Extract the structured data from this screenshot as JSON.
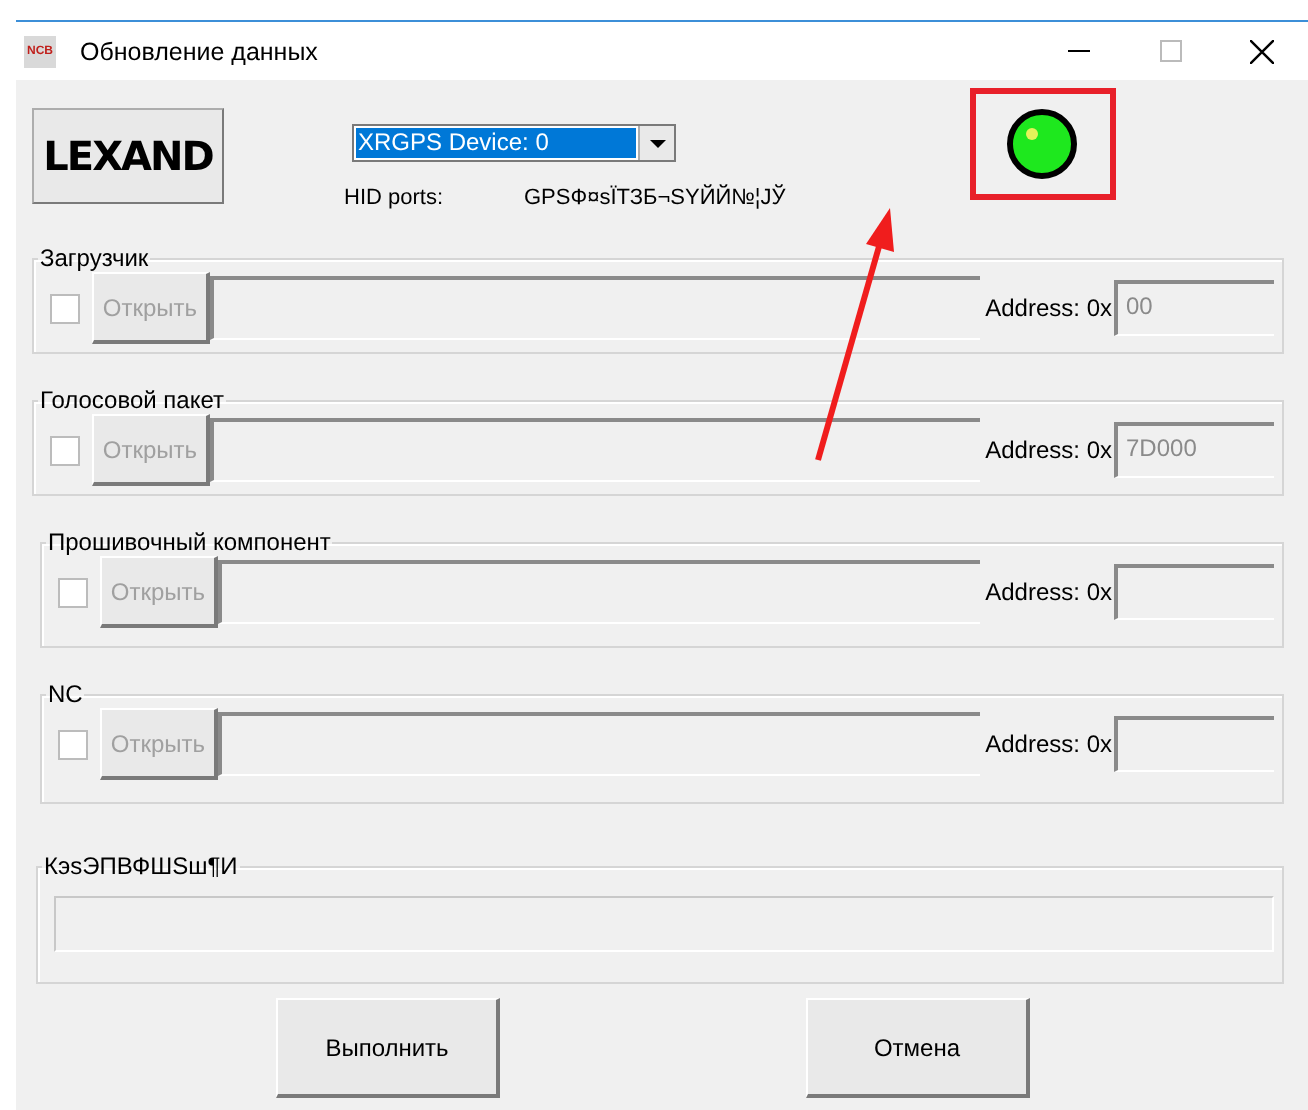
{
  "window": {
    "icon_text": "NCB",
    "title": "Обновление данных"
  },
  "logo": "LEXAND",
  "device_select": {
    "value": "XRGPS Device: 0"
  },
  "hid": {
    "label": "HID ports:",
    "value": "GPSФ¤sЇТЗБ¬SYЙЙ№¦JЎ"
  },
  "indicator": {
    "on": true,
    "highlighted": true
  },
  "groups": [
    {
      "title": "Загрузчик",
      "checked": false,
      "enabled": false,
      "open_button": "Открыть",
      "address_label": "Address: 0x",
      "address_value": "00"
    },
    {
      "title": "Голосовой пакет",
      "checked": false,
      "enabled": false,
      "open_button": "Открыть",
      "address_label": "Address: 0x",
      "address_value": "7D000"
    },
    {
      "title": "Прошивочный компонент",
      "checked": false,
      "enabled": false,
      "open_button": "Открыть",
      "address_label": "Address: 0x"
    },
    {
      "title": "NC",
      "checked": false,
      "enabled": false,
      "open_button": "Открыть",
      "address_label": "Address: 0x"
    }
  ],
  "status": {
    "title": "КэsЭПВФШSш¶И"
  },
  "buttons": [
    "Выполнить",
    "Отмена"
  ]
}
